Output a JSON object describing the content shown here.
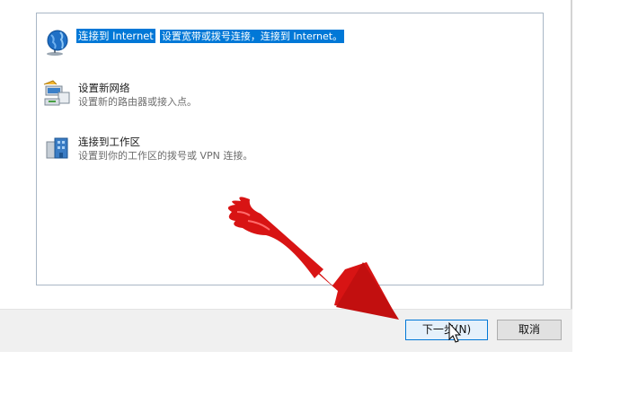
{
  "options": [
    {
      "title": "连接到 Internet",
      "desc": "设置宽带或拨号连接，连接到 Internet。",
      "icon": "globe-icon",
      "selected": true
    },
    {
      "title": "设置新网络",
      "desc": "设置新的路由器或接入点。",
      "icon": "router-icon",
      "selected": false
    },
    {
      "title": "连接到工作区",
      "desc": "设置到你的工作区的拨号或 VPN 连接。",
      "icon": "workplace-icon",
      "selected": false
    }
  ],
  "buttons": {
    "next_label": "下一步(N)",
    "cancel_label": "取消"
  },
  "colors": {
    "selection": "#0078d7",
    "annotation_arrow": "#d81414"
  }
}
